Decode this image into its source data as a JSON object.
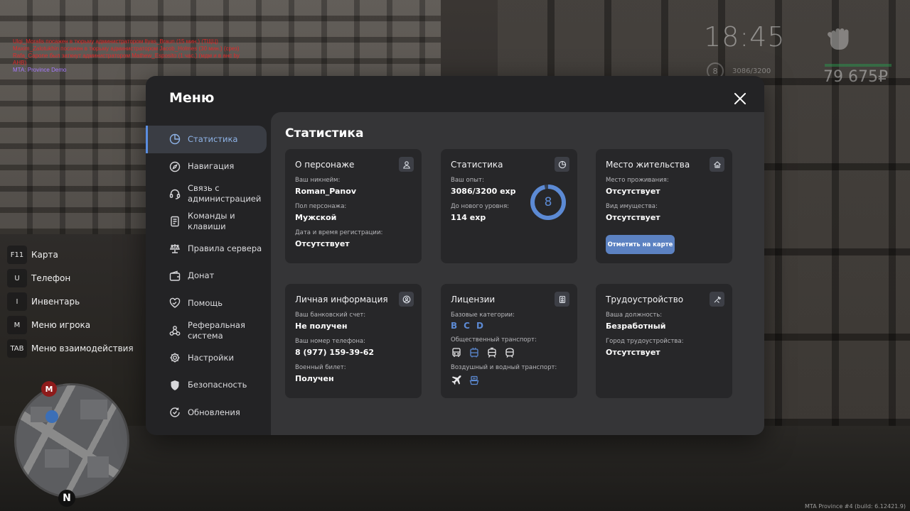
{
  "chat": {
    "lines": [
      "Ulqi_Moralis посажен в тюрьму администратором Ilyas_Braun (15 мин.) (ТЩЦ)",
      "Maxim_Zalotukhin посажен в тюрьму администратором Jacob_Holmes (30 мин.) (срез)",
      "Rafa_Capone был заткнут администратором Mathew_Esposito (1 час.) (мдм и в анс by AHB)"
    ],
    "footer": "MTA: Province Demo"
  },
  "hud": {
    "time": "18:45",
    "level": "8",
    "exp": "3086/3200",
    "money": "79 675₽"
  },
  "keybinds": [
    {
      "key": "F11",
      "label": "Карта"
    },
    {
      "key": "U",
      "label": "Телефон"
    },
    {
      "key": "I",
      "label": "Инвентарь"
    },
    {
      "key": "M",
      "label": "Меню игрока"
    },
    {
      "key": "TAB",
      "label": "Меню взаимодействия"
    }
  ],
  "minimap": {
    "metro": "M",
    "north": "N"
  },
  "build": "MTA Province #4 (build: 6.12421.9)",
  "menu": {
    "title": "Меню",
    "nav": [
      {
        "label": "Статистика",
        "icon": "pie-chart-icon",
        "active": true
      },
      {
        "label": "Навигация",
        "icon": "compass-icon"
      },
      {
        "label": "Связь с администрацией",
        "icon": "headset-icon"
      },
      {
        "label": "Команды и клавиши",
        "icon": "document-icon"
      },
      {
        "label": "Правила сервера",
        "icon": "scales-icon"
      },
      {
        "label": "Донат",
        "icon": "wallet-icon"
      },
      {
        "label": "Помощь",
        "icon": "heart-handshake-icon"
      },
      {
        "label": "Реферальная система",
        "icon": "referral-icon"
      },
      {
        "label": "Настройки",
        "icon": "gear-icon"
      },
      {
        "label": "Безопасность",
        "icon": "shield-icon"
      },
      {
        "label": "Обновления",
        "icon": "refresh-check-icon"
      }
    ],
    "content_title": "Статистика",
    "cards": {
      "character": {
        "title": "О персонаже",
        "nickname_label": "Ваш никнейм:",
        "nickname": "Roman_Panov",
        "gender_label": "Пол персонажа:",
        "gender": "Мужской",
        "reg_label": "Дата и время регистрации:",
        "reg": "Отсутствует"
      },
      "stats": {
        "title": "Статистика",
        "exp_label": "Ваш опыт:",
        "exp": "3086/3200 exp",
        "next_label": "До нового уровня:",
        "next": "114 exp",
        "level": "8",
        "progress": 0.964
      },
      "residence": {
        "title": "Место жительства",
        "place_label": "Место проживания:",
        "place": "Отсутствует",
        "property_label": "Вид имущества:",
        "property": "Отсутствует",
        "button": "Отметить на карте"
      },
      "personal": {
        "title": "Личная информация",
        "bank_label": "Ваш банковский счет:",
        "bank": "Не получен",
        "phone_label": "Ваш номер телефона:",
        "phone": "8 (977) 159-39-62",
        "military_label": "Военный билет:",
        "military": "Получен"
      },
      "licenses": {
        "title": "Лицензии",
        "base_label": "Базовые категории:",
        "base": [
          "B",
          "C",
          "D"
        ],
        "public_label": "Общественный транспорт:",
        "air_label": "Воздушный и водный транспорт:"
      },
      "employment": {
        "title": "Трудоустройство",
        "position_label": "Ваша должность:",
        "position": "Безработный",
        "city_label": "Город трудоустройства:",
        "city": "Отсутствует"
      }
    }
  },
  "colors": {
    "accent": "#5c8ad4",
    "button": "#5c82c2",
    "panel": "#232325",
    "content": "#353537",
    "card": "#272729"
  }
}
